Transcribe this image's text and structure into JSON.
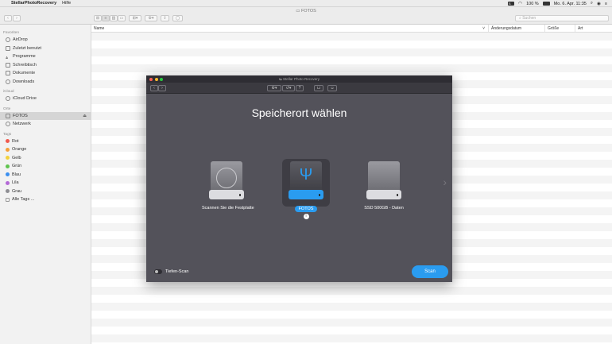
{
  "menubar": {
    "app": "StellarPhotoRecovery",
    "items": [
      "Hilfe"
    ],
    "battery": "100 %",
    "datetime": "Mo. 6. Apr. 11:35"
  },
  "finder": {
    "title": "FOTOS",
    "search_placeholder": "Suchen",
    "sidebar": {
      "favorites_header": "Favoriten",
      "favorites": [
        "AirDrop",
        "Zuletzt benutzt",
        "Programme",
        "Schreibtisch",
        "Dokumente",
        "Downloads"
      ],
      "icloud_header": "iCloud",
      "icloud": [
        "iCloud Drive"
      ],
      "places_header": "Orte",
      "places": [
        "FOTOS",
        "Netzwerk"
      ],
      "tags_header": "Tags",
      "tags": [
        {
          "label": "Rot",
          "color": "#f05a4f"
        },
        {
          "label": "Orange",
          "color": "#f4a13a"
        },
        {
          "label": "Gelb",
          "color": "#f3d23c"
        },
        {
          "label": "Grün",
          "color": "#5fc44f"
        },
        {
          "label": "Blau",
          "color": "#3b8ff0"
        },
        {
          "label": "Lila",
          "color": "#b46ad7"
        },
        {
          "label": "Grau",
          "color": "#8e8e93"
        }
      ],
      "all_tags": "Alle Tags ..."
    },
    "columns": [
      "Name",
      "Änderungsdatum",
      "Größe",
      "Art"
    ]
  },
  "stellar": {
    "window_title": "Stellar Photo Recovery",
    "heading": "Speicherort wählen",
    "drives": [
      {
        "label": "Scannen Sie die Festplatte",
        "selected": false
      },
      {
        "label": "FOTOS",
        "selected": true
      },
      {
        "label": "SSD 500GB - Daten",
        "selected": false
      }
    ],
    "info": "i",
    "deep_scan_label": "Tiefen-Scan",
    "scan_button": "Scan",
    "accent": "#2a9cf0"
  }
}
